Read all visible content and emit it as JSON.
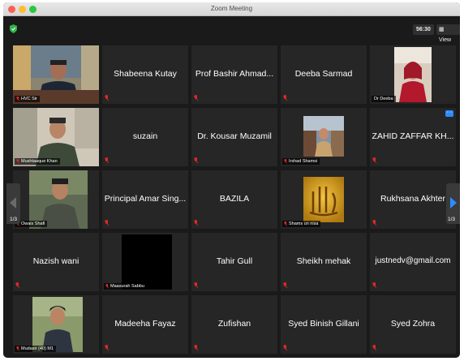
{
  "window": {
    "title": "Zoom Meeting"
  },
  "topbar": {
    "timer": "56:30",
    "view_label": "View",
    "view_icon": "grid-icon",
    "security_icon": "shield-icon"
  },
  "pagination": {
    "left": "1/3",
    "right": "1/3"
  },
  "colors": {
    "active_speaker": "#8cd24a",
    "muted": "#e02828",
    "tile_bg": "#262626",
    "accent": "#2d8cff"
  },
  "participants": [
    {
      "name": "HVC Sir",
      "video": true
    },
    {
      "name": "Shabeena Kutay"
    },
    {
      "name": "Prof Bashir Ahmad..."
    },
    {
      "name": "Deeba Sarmad"
    },
    {
      "name": "Dr Deeba",
      "video": true
    },
    {
      "name": "Mushtaaque Khan",
      "video": true
    },
    {
      "name": "suzain"
    },
    {
      "name": "Dr. Kousar Muzamil"
    },
    {
      "name": "Irshad Shamsi",
      "video": true
    },
    {
      "name": "ZAHID ZAFFAR KH..."
    },
    {
      "name": "Owais Shafi",
      "video": true
    },
    {
      "name": "Principal Amar Sing..."
    },
    {
      "name": "BAZILA"
    },
    {
      "name": "Shams un nisa",
      "video": true
    },
    {
      "name": "Rukhsana Akhter"
    },
    {
      "name": "Nazish wani"
    },
    {
      "name": "Maasurah Sabbu",
      "video": true
    },
    {
      "name": "Tahir Gull"
    },
    {
      "name": "Sheikh mehak"
    },
    {
      "name": "justnedv@gmail.com"
    },
    {
      "name": "Mudasir (40) M1",
      "video": true
    },
    {
      "name": "Madeeha Fayaz"
    },
    {
      "name": "Zufishan"
    },
    {
      "name": "Syed Binish Gillani"
    },
    {
      "name": "Syed Zohra"
    }
  ]
}
